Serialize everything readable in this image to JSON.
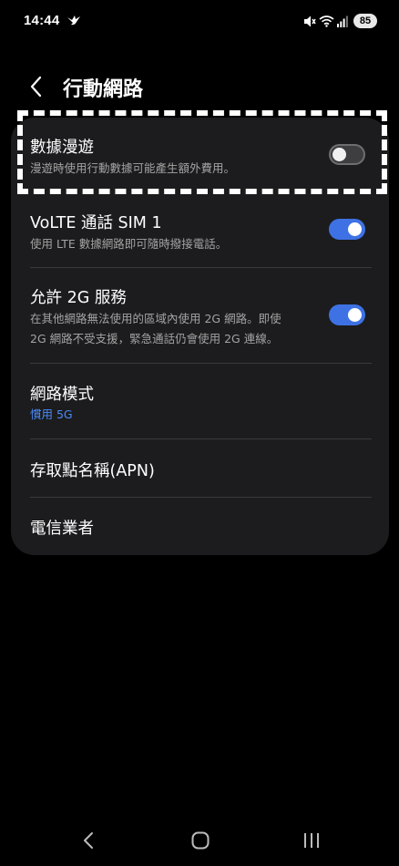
{
  "status_bar": {
    "time": "14:44",
    "battery": "85",
    "icons": [
      "bird-icon",
      "mute-icon",
      "wifi-icon",
      "signal-icon",
      "battery-icon"
    ]
  },
  "header": {
    "title": "行動網路",
    "back_icon": "chevron-left-icon"
  },
  "settings": {
    "roaming": {
      "title": "數據漫遊",
      "subtitle": "漫遊時使用行動數據可能產生額外費用。",
      "enabled": false
    },
    "volte": {
      "title": "VoLTE 通話 SIM 1",
      "subtitle": "使用 LTE 數據網路即可隨時撥接電話。",
      "enabled": true
    },
    "allow_2g": {
      "title": "允許 2G 服務",
      "subtitle_line1": "在其他網路無法使用的區域內使用 2G 網路。即使",
      "subtitle_line2": "2G 網路不受支援，緊急通話仍會使用 2G 連線。",
      "enabled": true
    },
    "network_mode": {
      "title": "網路模式",
      "value": "慣用 5G"
    },
    "apn": {
      "title": "存取點名稱(APN)"
    },
    "carrier": {
      "title": "電信業者"
    }
  },
  "navigation_bar": {
    "icons": [
      "back-icon",
      "home-icon",
      "recents-icon"
    ]
  },
  "colors": {
    "background": "#000000",
    "card": "#1c1c1e",
    "accent_toggle": "#3e72e4",
    "link_value": "#4a8cf7",
    "secondary_text": "#a3a3a3"
  }
}
